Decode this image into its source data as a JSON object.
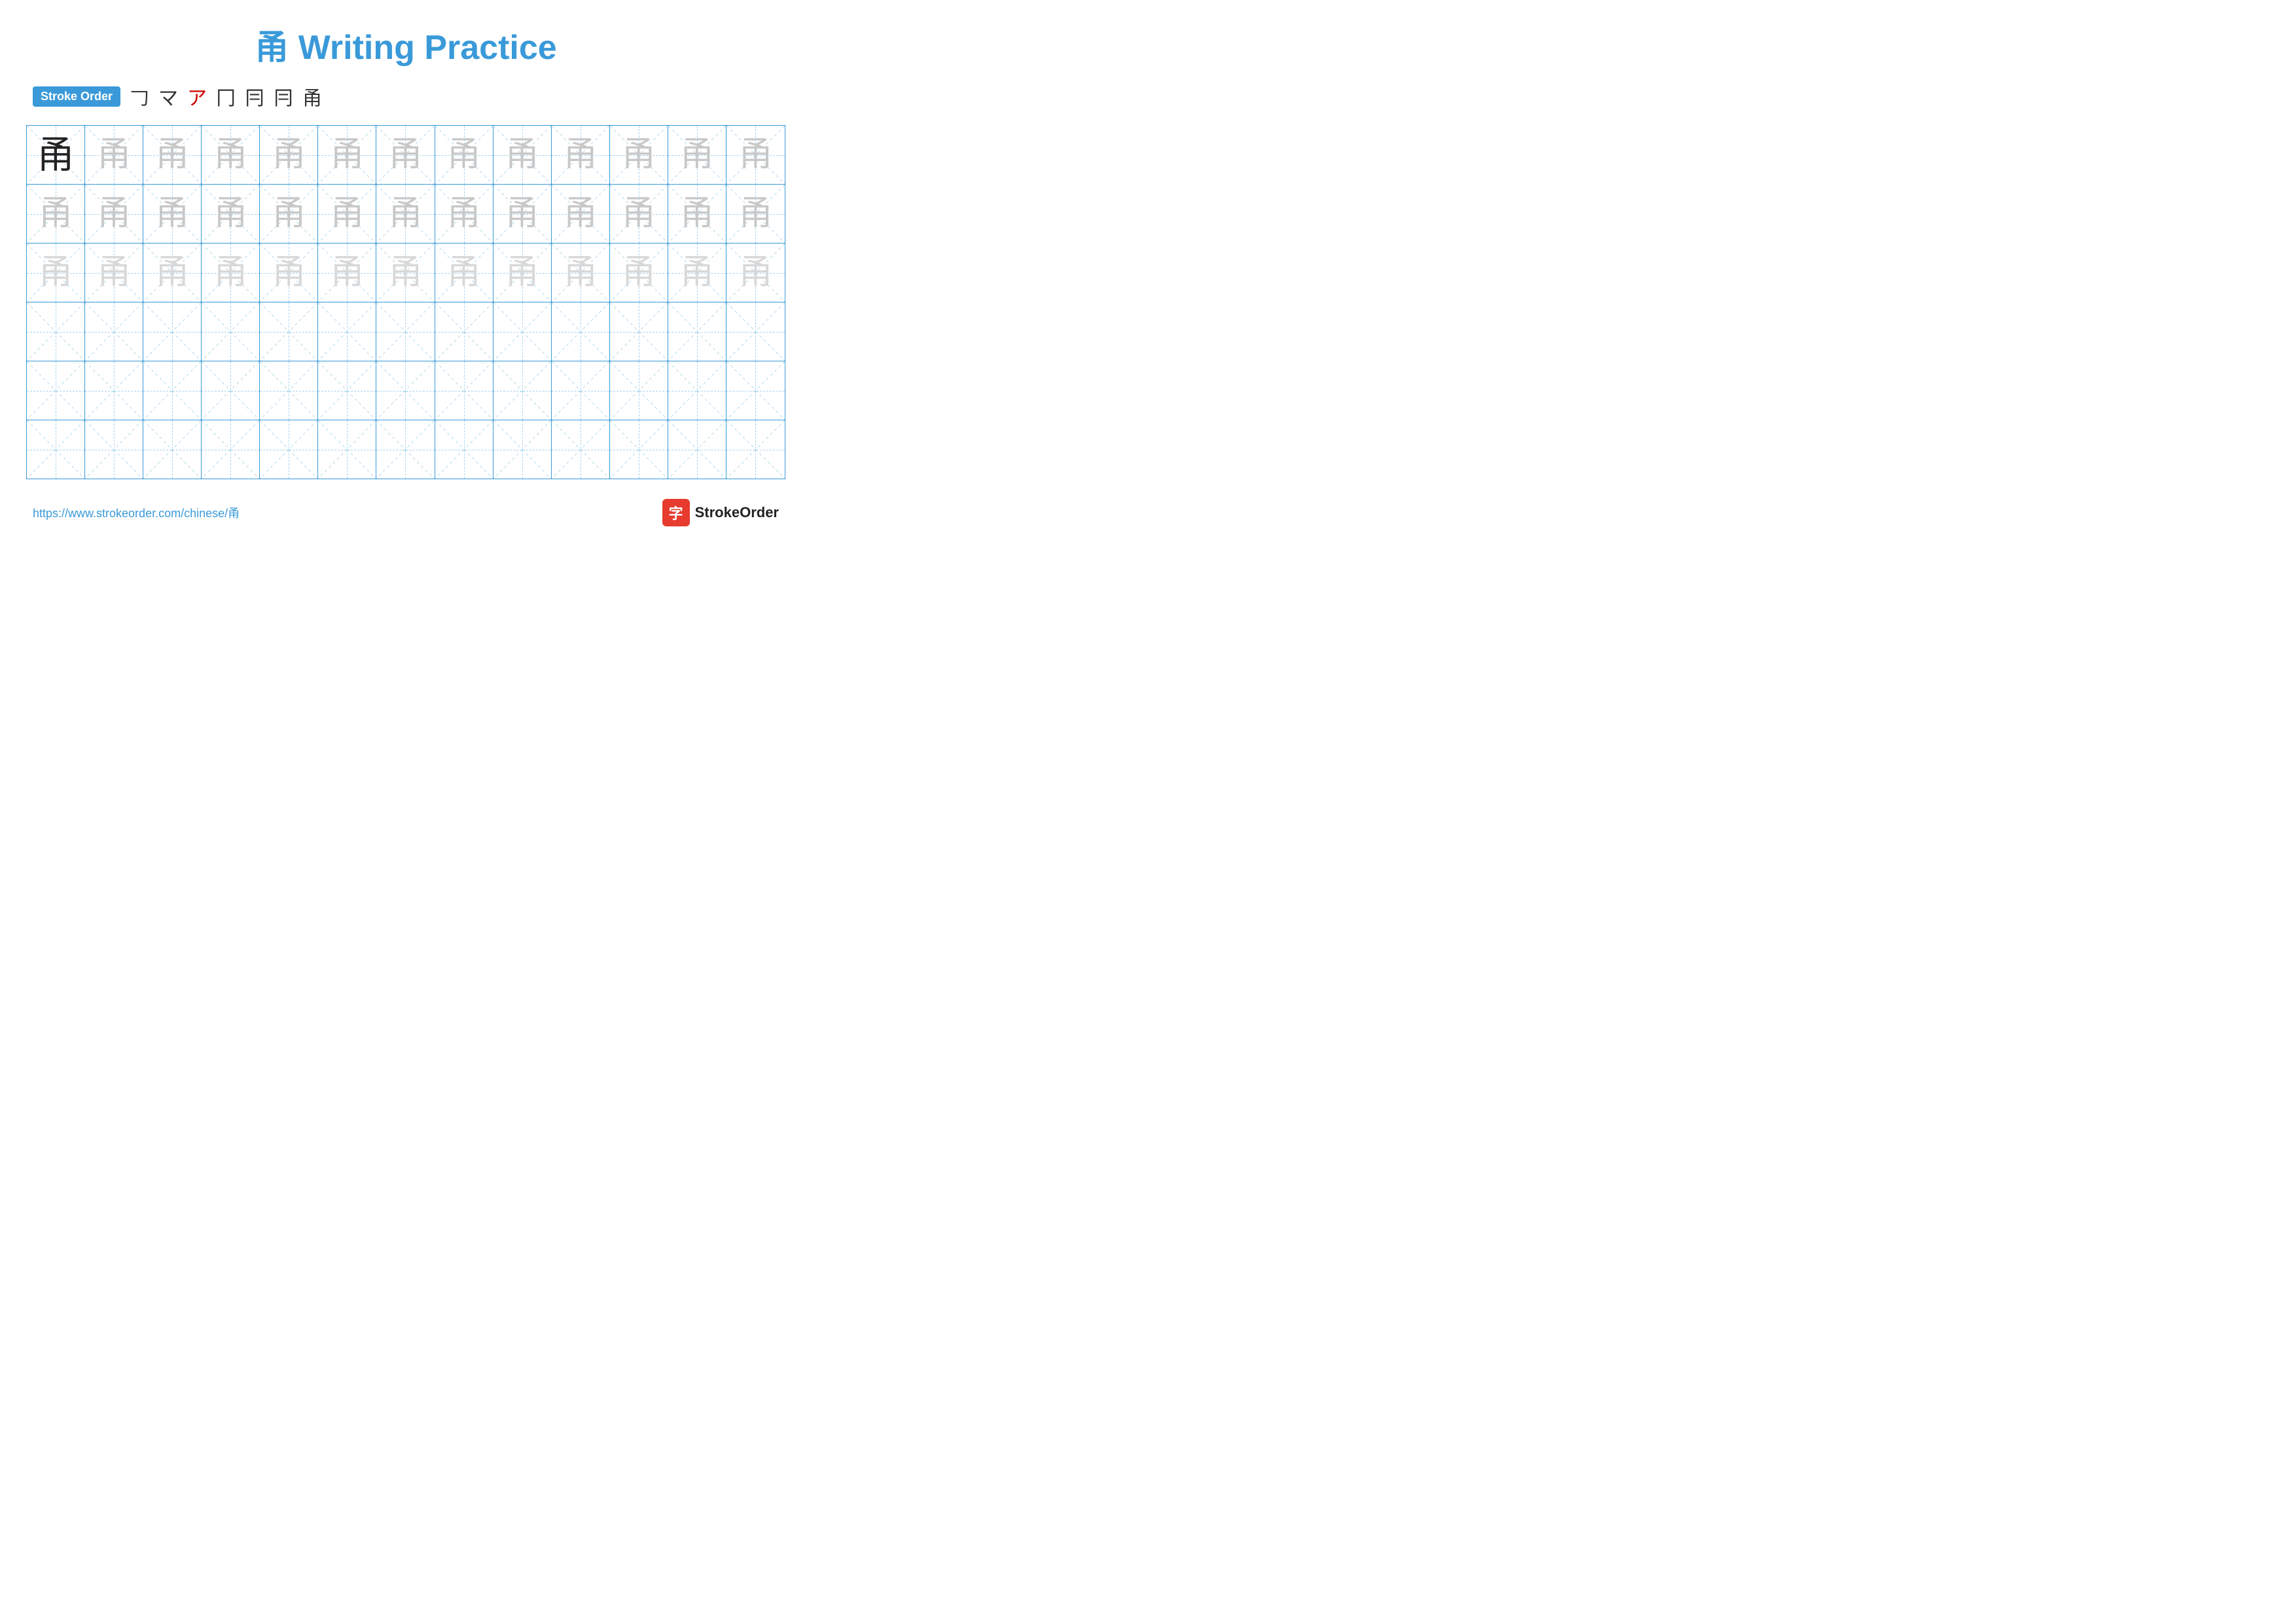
{
  "title": {
    "char": "甬",
    "text": "Writing Practice",
    "full": "甬 Writing Practice"
  },
  "stroke_order": {
    "badge_label": "Stroke Order",
    "steps": [
      "𠃌",
      "マ",
      "ア",
      "𠃊",
      "冂",
      "冃",
      "甬"
    ]
  },
  "grid": {
    "rows": 6,
    "cols": 13,
    "character": "甬",
    "row_types": [
      "dark_first",
      "medium",
      "light",
      "empty",
      "empty",
      "empty"
    ]
  },
  "footer": {
    "url": "https://www.strokeorder.com/chinese/甬",
    "logo_char": "字",
    "logo_text": "StrokeOrder"
  }
}
